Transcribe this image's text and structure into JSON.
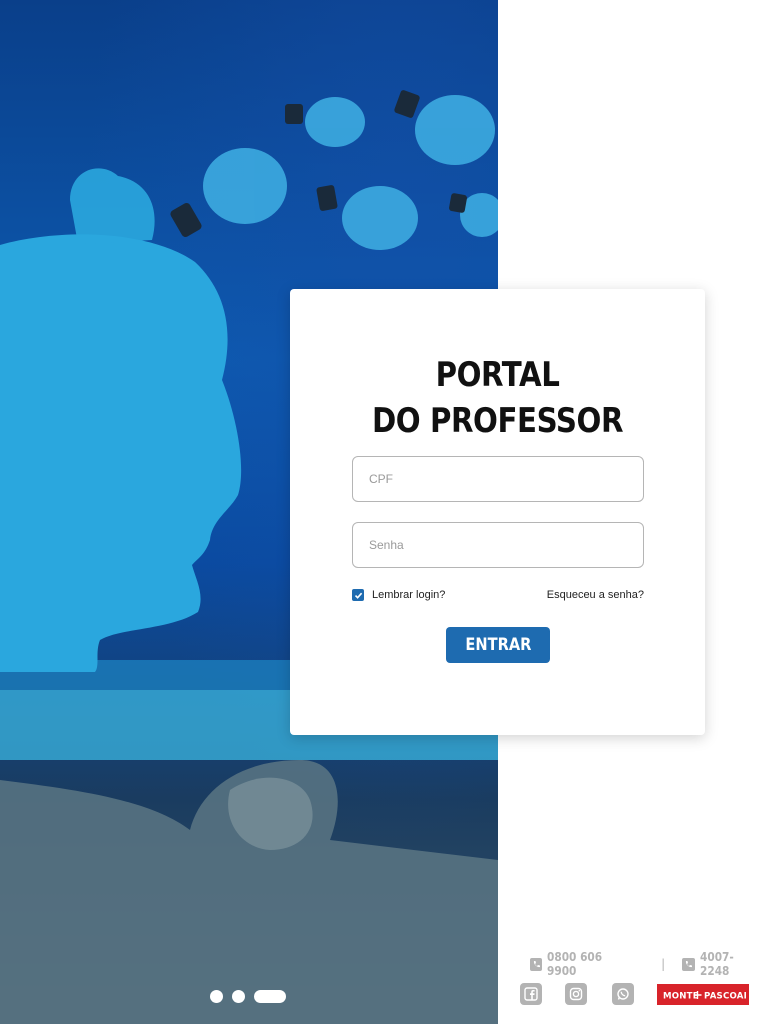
{
  "login": {
    "title_line1": "PORTAL",
    "title_line2": "DO PROFESSOR",
    "cpf_placeholder": "CPF",
    "senha_placeholder": "Senha",
    "remember_label": "Lembrar login?",
    "remember_checked": true,
    "forgot_label": "Esqueceu a senha?",
    "submit_label": "ENTRAR"
  },
  "footer": {
    "phone_1": "0800 606 9900",
    "separator": "|",
    "phone_2": "4007-2248",
    "social_icons": [
      "facebook-icon",
      "instagram-icon",
      "whatsapp-icon"
    ],
    "brand_logo": "MONTE PASCOAL"
  },
  "carousel": {
    "slide_count": 3,
    "active_index": 2
  },
  "colors": {
    "primary": "#1e6bb0",
    "brand_red": "#d8232a",
    "muted": "#b3b3b3"
  }
}
